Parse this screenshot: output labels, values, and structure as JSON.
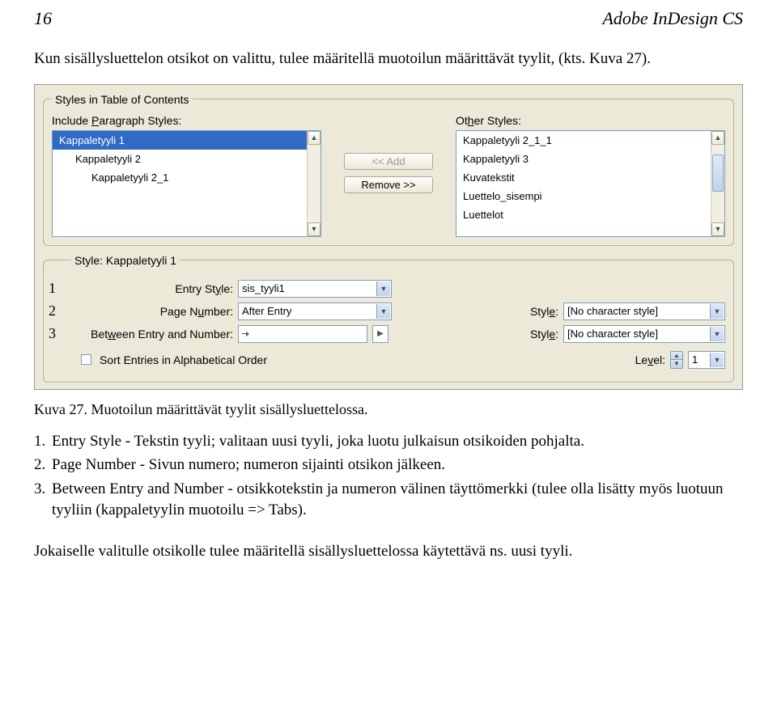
{
  "header": {
    "page_number": "16",
    "title": "Adobe InDesign CS"
  },
  "intro": "Kun sisällysluettelon otsikot on valittu, tulee määritellä muotoilun määrittävät tyylit, (kts. Kuva 27).",
  "panel": {
    "group_title": "Styles in Table of Contents",
    "include_label": "Include Paragraph Styles:",
    "other_label": "Other Styles:",
    "include_items": [
      {
        "label": "Kappaletyyli 1",
        "indent": 0,
        "selected": true
      },
      {
        "label": "Kappaletyyli 2",
        "indent": 1,
        "selected": false
      },
      {
        "label": "Kappaletyyli 2_1",
        "indent": 2,
        "selected": false
      }
    ],
    "other_items": [
      {
        "label": "Kappaletyyli 2_1_1"
      },
      {
        "label": "Kappaletyyli 3"
      },
      {
        "label": "Kuvatekstit"
      },
      {
        "label": "Luettelo_sisempi"
      },
      {
        "label": "Luettelot"
      }
    ],
    "btn_add": "<< Add",
    "btn_remove": "Remove >>",
    "style_group_title": "Style: Kappaletyyli 1",
    "row1": {
      "label": "Entry Style:",
      "value": "sis_tyyli1"
    },
    "row2": {
      "label": "Page Number:",
      "value": "After Entry",
      "style_label": "Style:",
      "style_value": "[No character style]"
    },
    "row3": {
      "label": "Between Entry and Number:",
      "value": "",
      "style_label": "Style:",
      "style_value": "[No character style]"
    },
    "sort_label": "Sort Entries in Alphabetical Order",
    "level_label": "Level:",
    "level_value": "1",
    "annotations": {
      "r1": "1",
      "r2": "2",
      "r3": "3"
    }
  },
  "caption": "Kuva 27. Muotoilun määrittävät tyylit sisällysluettelossa.",
  "list": {
    "i1": {
      "n": "1.",
      "text": "Entry Style - Tekstin tyyli; valitaan uusi tyyli, joka luotu julkaisun otsikoiden pohjalta."
    },
    "i2": {
      "n": "2.",
      "text": "Page Number - Sivun numero; numeron sijainti otsikon jälkeen."
    },
    "i3": {
      "n": "3.",
      "text": "Between Entry and Number - otsikkotekstin ja numeron välinen täyttömerkki (tulee olla lisätty myös luotuun tyyliin (kappaletyylin muotoilu => Tabs)."
    }
  },
  "closing": "Jokaiselle valitulle otsikolle tulee määritellä sisällysluettelossa käytettävä ns. uusi tyyli."
}
